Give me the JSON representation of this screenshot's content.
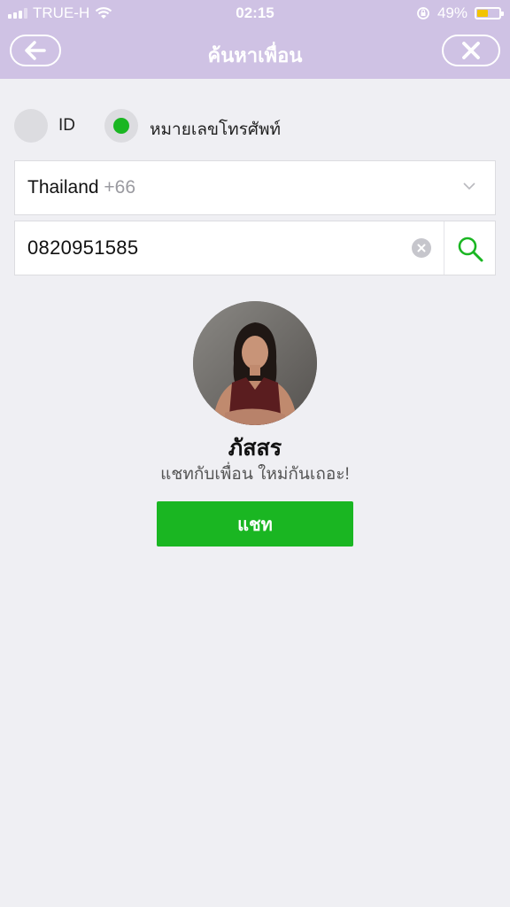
{
  "status_bar": {
    "carrier": "TRUE-H",
    "time": "02:15",
    "battery_percent": "49%",
    "battery_level": 0.45
  },
  "header": {
    "title": "ค้นหาเพื่อน",
    "back_icon": "arrow-left-icon",
    "close_icon": "close-icon"
  },
  "search_mode": {
    "options": [
      {
        "label": "ID",
        "selected": false
      },
      {
        "label": "หมายเลขโทรศัพท์",
        "selected": true
      }
    ]
  },
  "country": {
    "name": "Thailand",
    "code": "+66"
  },
  "phone_input": {
    "value": "0820951585"
  },
  "result": {
    "name": "ภัสสร",
    "message": "แชทกับเพื่อน ใหม่กันเถอะ!",
    "button_label": "แชท"
  },
  "colors": {
    "header_bg": "#cfc2e4",
    "accent_green": "#1ab622",
    "page_bg": "#efeff3"
  }
}
